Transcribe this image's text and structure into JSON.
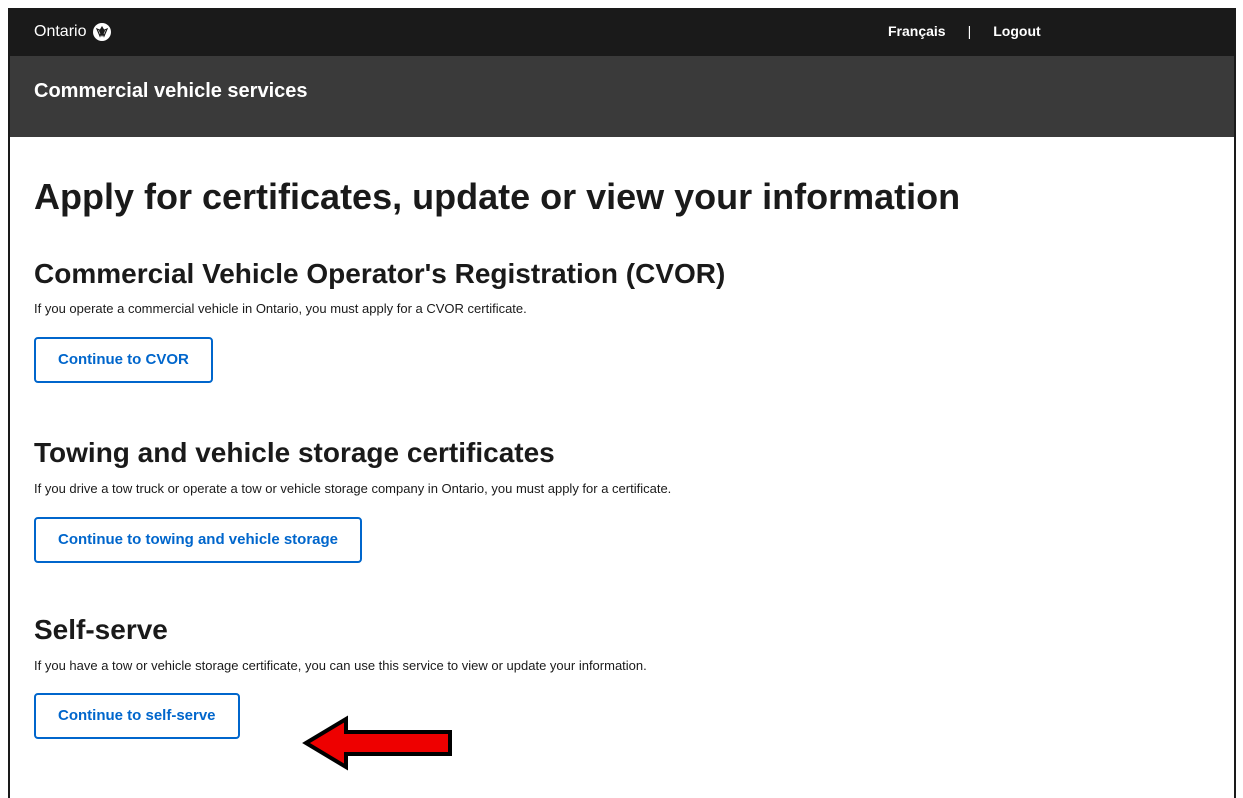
{
  "header": {
    "brand": "Ontario",
    "language_link": "Français",
    "separator": "|",
    "logout_link": "Logout"
  },
  "subheader": {
    "title": "Commercial vehicle services"
  },
  "main": {
    "title": "Apply for certificates, update or view your information",
    "sections": [
      {
        "heading": "Commercial Vehicle Operator's Registration (CVOR)",
        "description": "If you operate a commercial vehicle in Ontario, you must apply for a CVOR certificate.",
        "button_label": "Continue to CVOR"
      },
      {
        "heading": "Towing and vehicle storage certificates",
        "description": "If you drive a tow truck or operate a tow or vehicle storage company in Ontario, you must apply for a certificate.",
        "button_label": "Continue to towing and vehicle storage"
      },
      {
        "heading": "Self-serve",
        "description": "If you have a tow or vehicle storage certificate, you can use this service to view or update your information.",
        "button_label": "Continue to self-serve"
      }
    ]
  },
  "annotation": {
    "icon": "left-arrow-icon",
    "color": "#ee0000"
  },
  "colors": {
    "topbar": "#1a1a1a",
    "subbar": "#3a3a3a",
    "button_accent": "#0066cc"
  }
}
